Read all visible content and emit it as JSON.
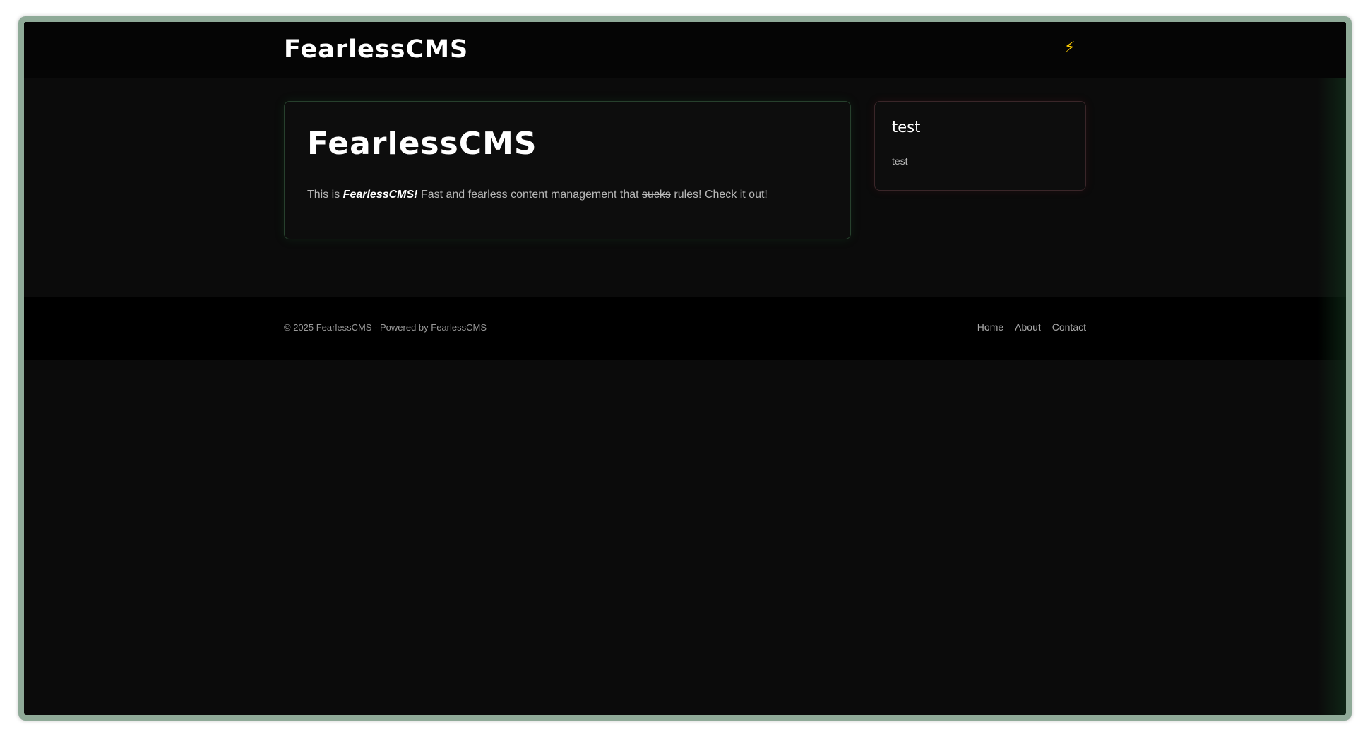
{
  "header": {
    "site_title": "FearlessCMS",
    "theme_icon": "lightning-bolt-icon",
    "theme_glyph": "⚡"
  },
  "post": {
    "title": "FearlessCMS",
    "body_prefix": "This is ",
    "body_bold": "FearlessCMS!",
    "body_middle": " Fast and fearless content management that ",
    "body_strike": "sucks",
    "body_suffix": " rules! Check it out!"
  },
  "sidebar": {
    "widget_title": "test",
    "widget_body": "test"
  },
  "footer": {
    "copyright": "© 2025 FearlessCMS - Powered by FearlessCMS",
    "links": [
      {
        "label": "Home"
      },
      {
        "label": "About"
      },
      {
        "label": "Contact"
      }
    ]
  },
  "colors": {
    "background": "#0b0b0b",
    "header": "#050505",
    "footer": "#000000",
    "frame": "#8faa98",
    "accent_green_border": "#27402d",
    "accent_red_border": "#3a2629",
    "bolt": "#ffcc00"
  }
}
